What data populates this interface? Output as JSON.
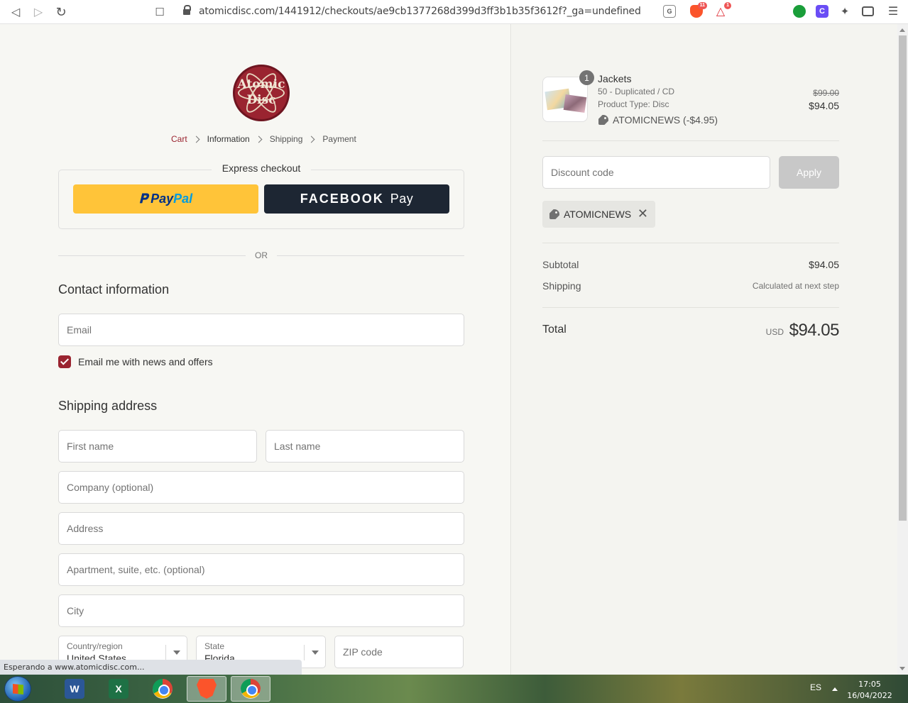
{
  "browser": {
    "url": "atomicdisc.com/1441912/checkouts/ae9cb1377268d399d3ff3b1b35f3612f?_ga=undefined",
    "brave_shield_count": "11",
    "brave_rewards_count": "1",
    "status_text": "Esperando a www.atomicdisc.com..."
  },
  "logo": {
    "line1": "Atomic",
    "line2": "Disc"
  },
  "breadcrumbs": {
    "cart": "Cart",
    "information": "Information",
    "shipping": "Shipping",
    "payment": "Payment"
  },
  "express": {
    "title": "Express checkout",
    "paypal_pay": "Pay",
    "paypal_pal": "Pal",
    "facebook": "FACEBOOK",
    "facebook_pay": "Pay",
    "or": "OR"
  },
  "contact": {
    "title": "Contact information",
    "email_placeholder": "Email",
    "newsletter_label": "Email me with news and offers"
  },
  "shipping": {
    "title": "Shipping address",
    "first_name": "First name",
    "last_name": "Last name",
    "company": "Company (optional)",
    "address": "Address",
    "apartment": "Apartment, suite, etc. (optional)",
    "city": "City",
    "country_label": "Country/region",
    "country_value": "United States",
    "state_label": "State",
    "state_value": "Florida",
    "zip": "ZIP code"
  },
  "order": {
    "quantity": "1",
    "product_name": "Jackets",
    "variant": "50 - Duplicated / CD",
    "product_type": "Product Type: Disc",
    "discount_line": "ATOMICNEWS (-$4.95)",
    "price_original": "$99.00",
    "price_final": "$94.05",
    "discount_placeholder": "Discount code",
    "apply_label": "Apply",
    "applied_code": "ATOMICNEWS",
    "subtotal_label": "Subtotal",
    "subtotal_value": "$94.05",
    "shipping_label": "Shipping",
    "shipping_value": "Calculated at next step",
    "total_label": "Total",
    "currency": "USD",
    "total_value": "$94.05"
  },
  "taskbar": {
    "language": "ES",
    "time": "17:05",
    "date": "16/04/2022"
  },
  "colors": {
    "accent": "#9a2430",
    "paypal_yellow": "#ffc439",
    "facebook_pay_bg": "#1d2633"
  }
}
